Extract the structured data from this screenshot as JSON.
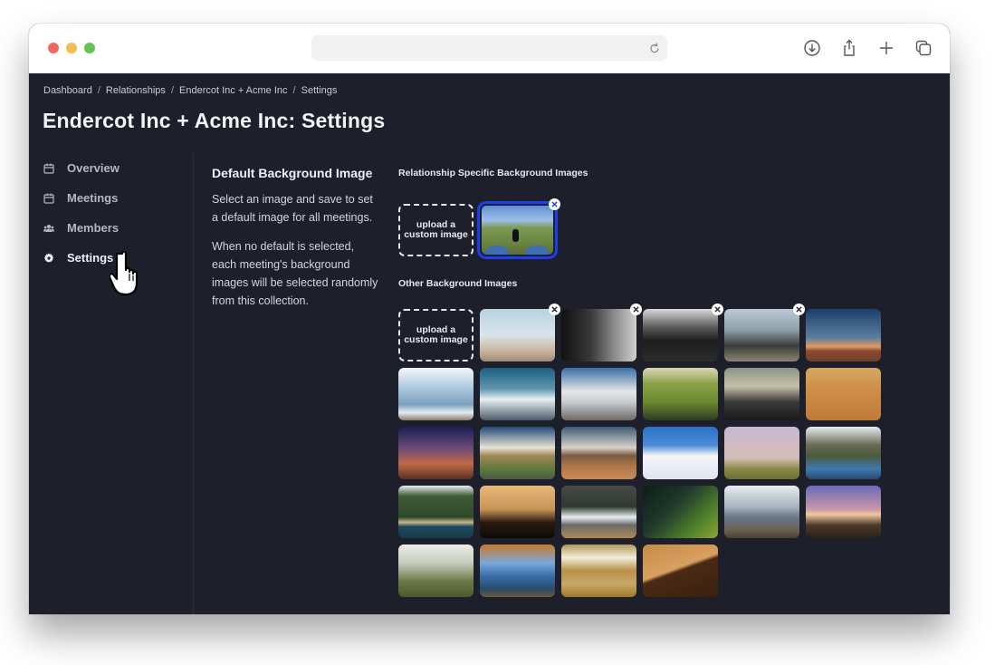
{
  "browser": {
    "url": "",
    "toolbar_icons": [
      "download-icon",
      "share-icon",
      "new-tab-icon",
      "tabs-overview-icon"
    ]
  },
  "breadcrumb": [
    {
      "label": "Dashboard"
    },
    {
      "label": "Relationships"
    },
    {
      "label": "Endercot Inc + Acme Inc"
    },
    {
      "label": "Settings"
    }
  ],
  "page": {
    "title": "Endercot Inc + Acme Inc: Settings"
  },
  "sidebar": {
    "items": [
      {
        "label": "Overview",
        "icon": "calendar-icon",
        "active": false
      },
      {
        "label": "Meetings",
        "icon": "calendar-icon",
        "active": false
      },
      {
        "label": "Members",
        "icon": "users-icon",
        "active": false
      },
      {
        "label": "Settings",
        "icon": "gear-icon",
        "active": true
      }
    ]
  },
  "description": {
    "heading": "Default Background Image",
    "paragraph1": "Select an image and save to set a default image for all meetings.",
    "paragraph2": "When no default is selected, each meeting's background images will be selected randomly from this collection."
  },
  "relationship_images": {
    "label": "Relationship Specific Background Images",
    "upload_label": "upload a custom image",
    "images": [
      {
        "subject": "dog on countryside path (selected)",
        "selected": true,
        "removable": true
      }
    ]
  },
  "other_images": {
    "label": "Other Background Images",
    "upload_label": "upload a custom image",
    "images": [
      {
        "subject": "three people on beach",
        "removable": true
      },
      {
        "subject": "man in black and white",
        "removable": true
      },
      {
        "subject": "team sitting on stairs",
        "removable": true
      },
      {
        "subject": "group photo outdoors",
        "removable": true
      },
      {
        "subject": "desert at dusk",
        "removable": false
      },
      {
        "subject": "misty mountains with animal",
        "removable": false
      },
      {
        "subject": "snowy peak with sun",
        "removable": false
      },
      {
        "subject": "dolomite peaks",
        "removable": false
      },
      {
        "subject": "green canyon waterfall",
        "removable": false
      },
      {
        "subject": "volcano with clouds",
        "removable": false
      },
      {
        "subject": "orange sand dunes",
        "removable": false
      },
      {
        "subject": "milky way over rocks",
        "removable": false
      },
      {
        "subject": "rock castle formation",
        "removable": false
      },
      {
        "subject": "desert rock on sand",
        "removable": false
      },
      {
        "subject": "snowy ridge blue sky",
        "removable": false
      },
      {
        "subject": "lone tree in field",
        "removable": false
      },
      {
        "subject": "river through gorge",
        "removable": false
      },
      {
        "subject": "green coastline",
        "removable": false
      },
      {
        "subject": "deer silhouette at sunset",
        "removable": false
      },
      {
        "subject": "coastal cliff waves",
        "removable": false
      },
      {
        "subject": "aerial jungle and water",
        "removable": false
      },
      {
        "subject": "snowy mountain peaks",
        "removable": false
      },
      {
        "subject": "dragon tree at sunset",
        "removable": false
      },
      {
        "subject": "misty forest",
        "removable": false
      },
      {
        "subject": "autumn tree by lake",
        "removable": false
      },
      {
        "subject": "aerial beach waves",
        "removable": false
      },
      {
        "subject": "sand dune shadow",
        "removable": false
      }
    ]
  },
  "colors": {
    "background": "#1d202b",
    "selected_border": "#1a3df5",
    "text_primary": "#f4f5f7",
    "text_muted": "#b3b8c4"
  }
}
